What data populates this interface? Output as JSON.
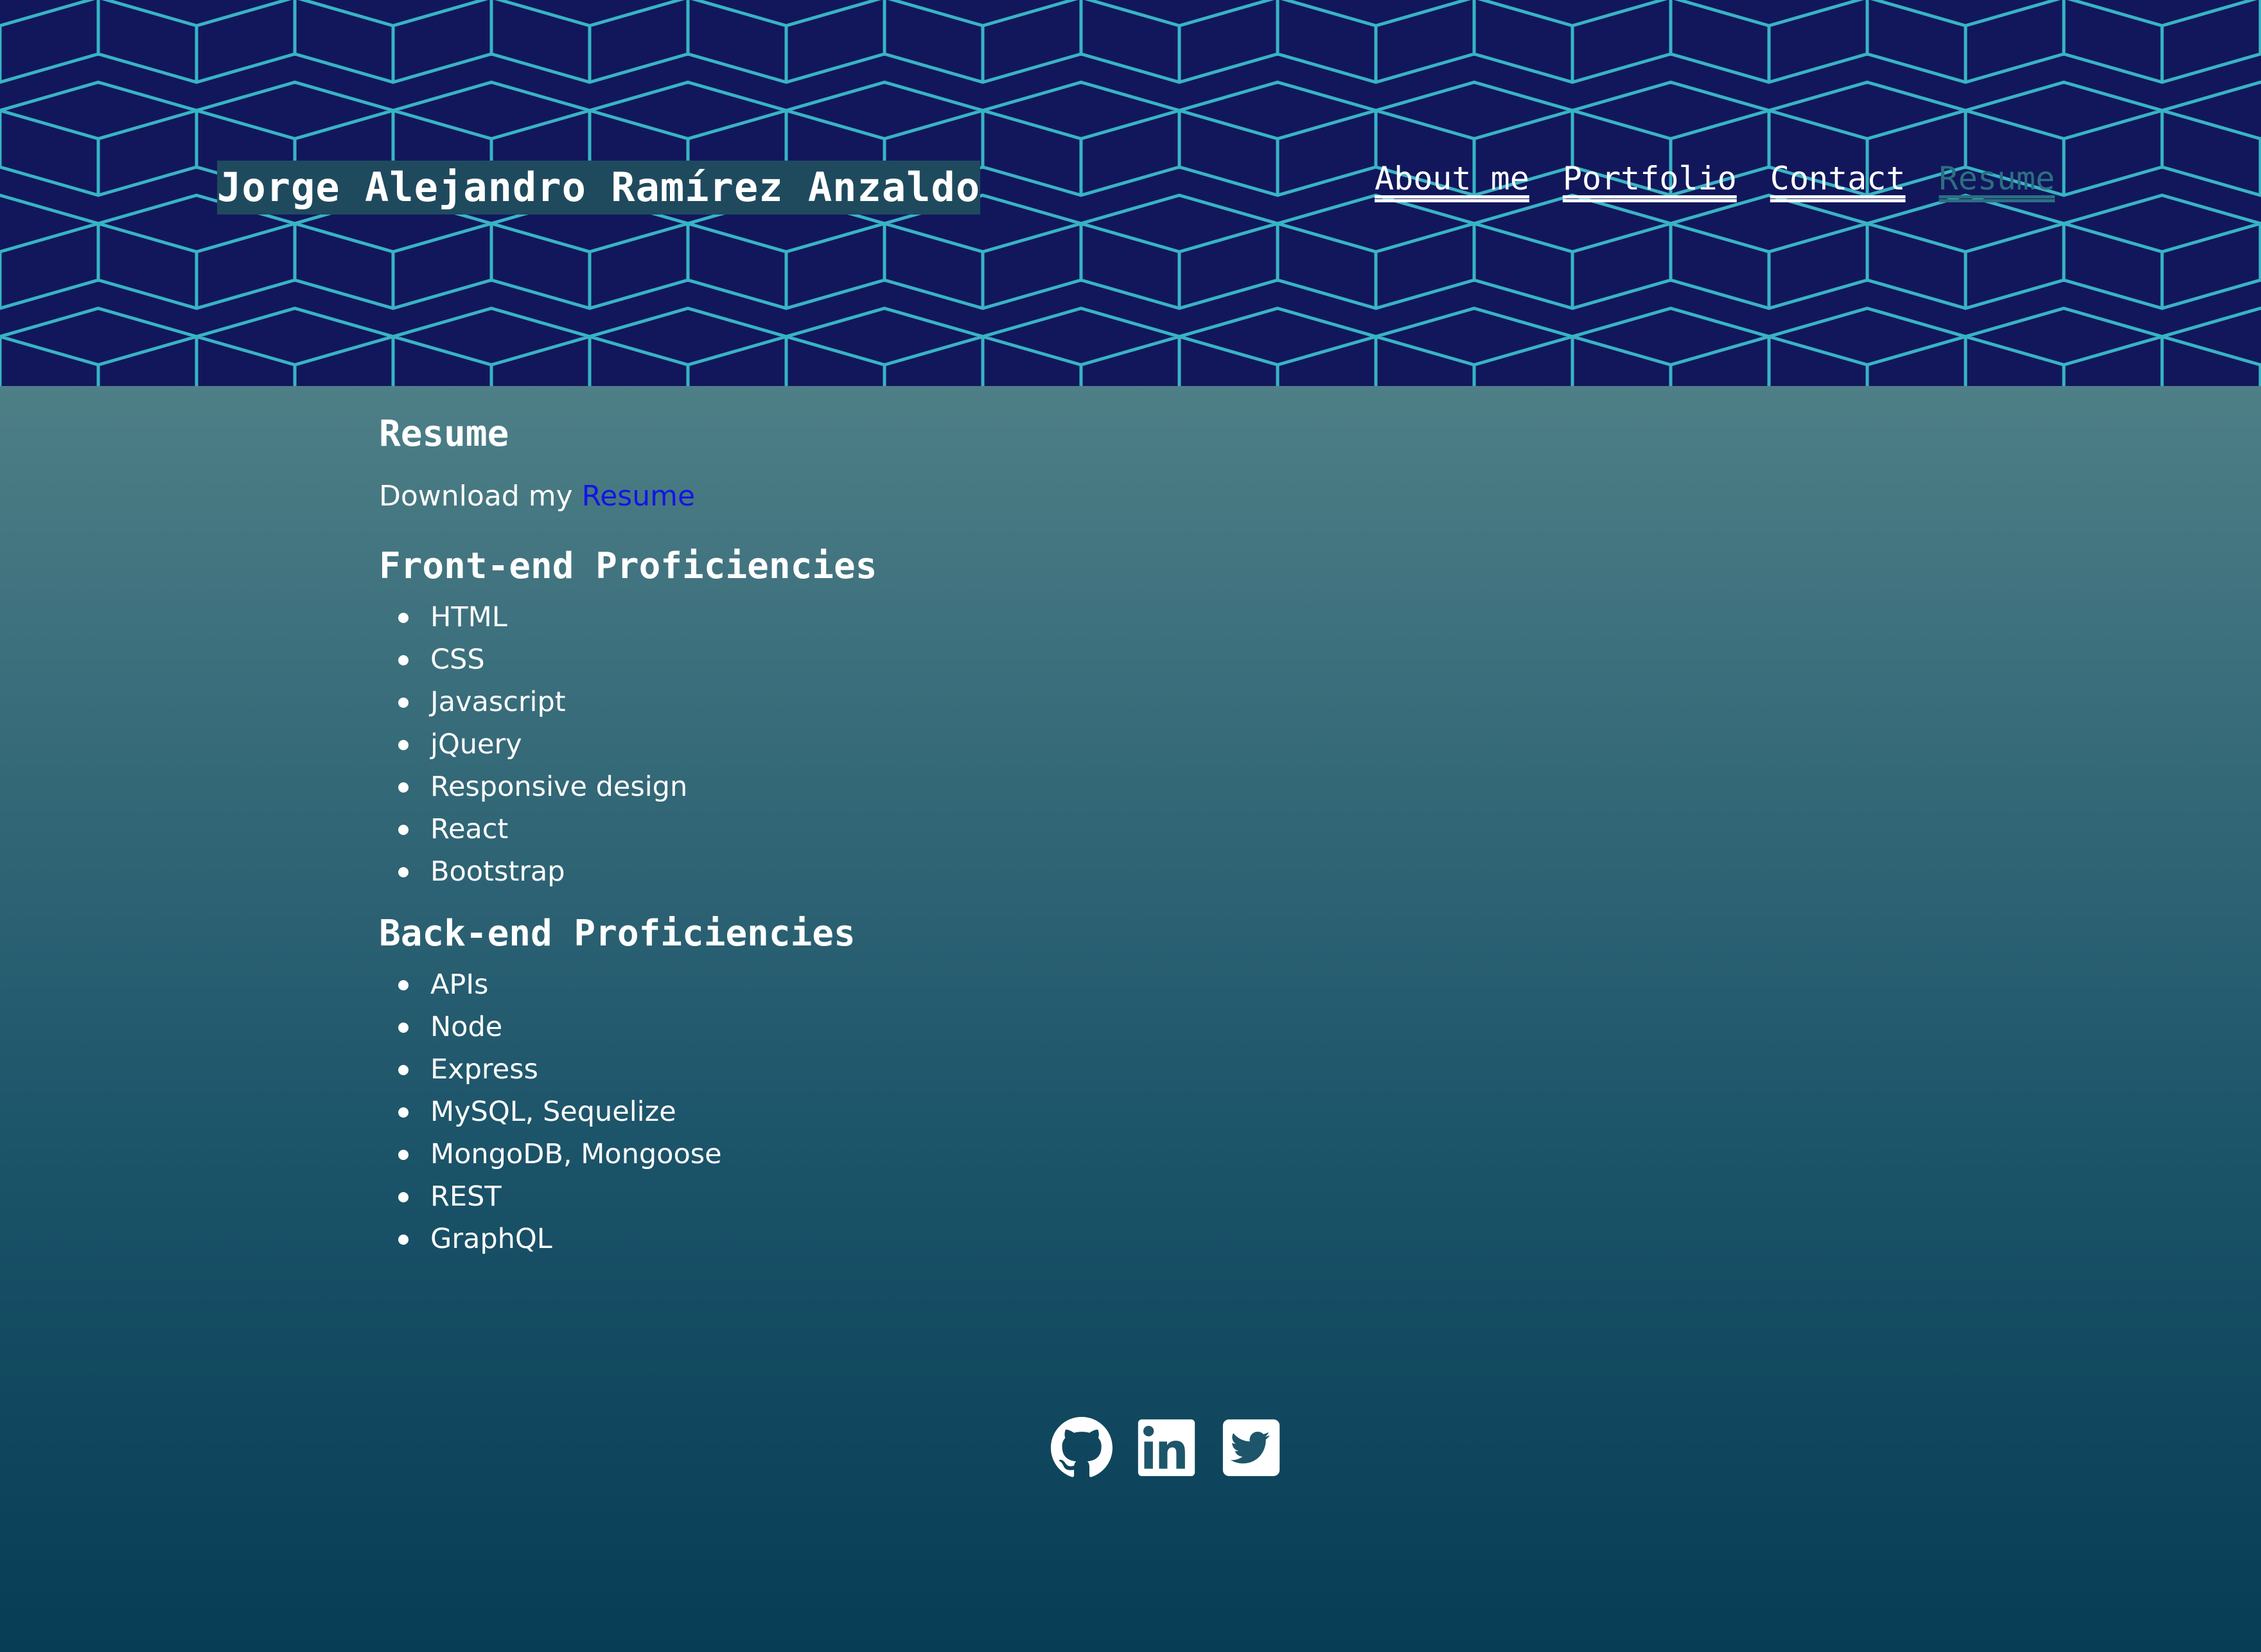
{
  "header": {
    "title": "Jorge Alejandro Ramírez Anzaldo",
    "nav": [
      {
        "label": "About me",
        "active": false
      },
      {
        "label": "Portfolio",
        "active": false
      },
      {
        "label": "Contact",
        "active": false
      },
      {
        "label": "Resume",
        "active": true
      }
    ]
  },
  "resume": {
    "heading": "Resume",
    "download_prefix": "Download my",
    "download_link": "Resume"
  },
  "frontend": {
    "heading": "Front-end Proficiencies",
    "items": [
      "HTML",
      "CSS",
      "Javascript",
      "jQuery",
      "Responsive design",
      "React",
      "Bootstrap"
    ]
  },
  "backend": {
    "heading": "Back-end Proficiencies",
    "items": [
      "APIs",
      "Node",
      "Express",
      "MySQL, Sequelize",
      "MongoDB, Mongoose",
      "REST",
      "GraphQL"
    ]
  },
  "socials": [
    {
      "icon": "github-icon"
    },
    {
      "icon": "linkedin-icon"
    },
    {
      "icon": "twitter-icon"
    }
  ],
  "colors": {
    "hero_bg": "#12175c",
    "hex_line": "#3fd0d6",
    "title_bg": "#1f4a5e",
    "active_nav": "#2b6f82",
    "link": "#1414e6"
  }
}
